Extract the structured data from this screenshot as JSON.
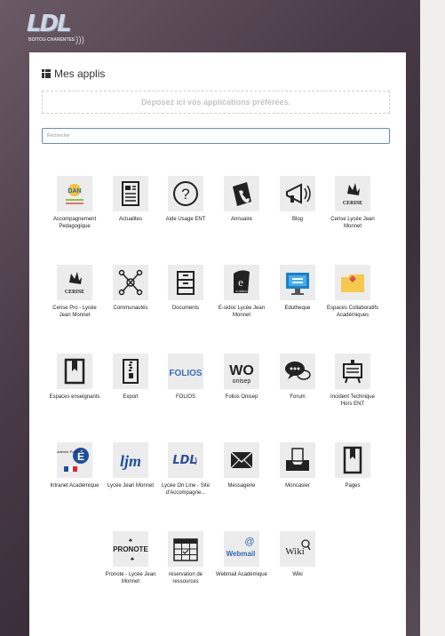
{
  "header": {
    "logo_text": "LDL",
    "logo_subtitle": "BOITOU-CHARENTES",
    "logo_wave": ")))"
  },
  "panel": {
    "title": "Mes applis",
    "dropzone_text": "Déposez ici vos applications préférées.",
    "search_placeholder": "Rechercher"
  },
  "apps": [
    {
      "label": "Accompagnement Pedagogique",
      "icon": "dan-logo-icon",
      "text": "DAN"
    },
    {
      "label": "Actualites",
      "icon": "news-document-icon"
    },
    {
      "label": "Aide Usage ENT",
      "icon": "help-question-icon",
      "text": "?"
    },
    {
      "label": "Annuaire",
      "icon": "address-book-icon"
    },
    {
      "label": "Blog",
      "icon": "megaphone-icon"
    },
    {
      "label": "Cerise Lycée Jean Monnet",
      "icon": "cerise-logo-icon",
      "text": "CERISE"
    },
    {
      "label": "Cerise Pro - Lycée Jean Monnet",
      "icon": "cerise-pro-logo-icon",
      "text": "CERISE"
    },
    {
      "label": "Communautés",
      "icon": "community-network-icon"
    },
    {
      "label": "Documents",
      "icon": "file-cabinet-icon"
    },
    {
      "label": "E-sidoc Lycée Jean Monnet",
      "icon": "esidoc-logo-icon",
      "text": "e-sidoc"
    },
    {
      "label": "Edutheque",
      "icon": "edutheque-monitor-icon"
    },
    {
      "label": "Espaces Collaboratifs Académiques",
      "icon": "folder-icon"
    },
    {
      "label": "Espaces enseignants",
      "icon": "bookmark-book-icon"
    },
    {
      "label": "Export",
      "icon": "zip-file-icon"
    },
    {
      "label": "FOLIOS",
      "icon": "folios-logo-icon",
      "text": "FOLIOS"
    },
    {
      "label": "Folios Onisep",
      "icon": "onisep-logo-icon",
      "text": "WO",
      "text2": "onisep"
    },
    {
      "label": "Forum",
      "icon": "chat-bubbles-icon"
    },
    {
      "label": "Incident Technique Hors ENT",
      "icon": "incident-board-icon"
    },
    {
      "label": "Intranet Académique",
      "icon": "academie-poitiers-logo-icon",
      "text": "académie Poitiers"
    },
    {
      "label": "Lycée Jean Monnet",
      "icon": "ljm-logo-icon",
      "text": "ljm"
    },
    {
      "label": "Lycée On Line - Site d'Accompagne...",
      "icon": "ldl-logo-icon",
      "text": "LDL"
    },
    {
      "label": "Messagerie",
      "icon": "envelope-icon"
    },
    {
      "label": "Moncasier",
      "icon": "inbox-tray-icon"
    },
    {
      "label": "Pages",
      "icon": "bookmark-page-icon"
    },
    {
      "label": "Pronote - Lycée Jean Monnet",
      "icon": "pronote-logo-icon",
      "text": "PRONOTE"
    },
    {
      "label": "réservation de ressources",
      "icon": "calendar-grid-icon"
    },
    {
      "label": "Webmail Académique",
      "icon": "webmail-logo-icon",
      "text": "Webmail",
      "text2": "@"
    },
    {
      "label": "Wiki",
      "icon": "wiki-logo-icon",
      "text": "Wiki"
    }
  ],
  "colors": {
    "accent": "#5b8ed6",
    "panel_bg": "#ffffff",
    "tile_bg": "#ececec",
    "icon_dark": "#222222"
  }
}
